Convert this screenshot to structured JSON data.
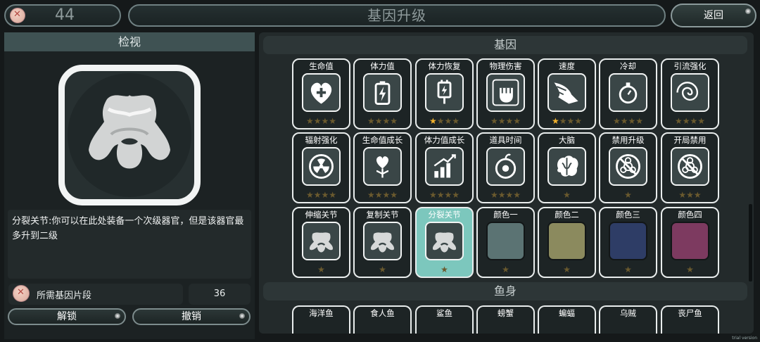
{
  "header": {
    "currency_value": "44",
    "title": "基因升级",
    "back_label": "返回"
  },
  "inspect": {
    "title": "检视",
    "description": "分裂关节:你可以在此处装备一个次级器官，但是该器官最多升到二级",
    "cost_label": "所需基因片段",
    "cost_value": "36",
    "unlock_label": "解锁",
    "cancel_label": "撤销"
  },
  "genes": {
    "title": "基因",
    "items": [
      {
        "name": "生命值",
        "icon": "heart-plus-icon",
        "stars": [
          0,
          0,
          0,
          0
        ]
      },
      {
        "name": "体力值",
        "icon": "battery-icon",
        "stars": [
          0,
          0,
          0,
          0
        ]
      },
      {
        "name": "体力恢复",
        "icon": "charger-icon",
        "stars": [
          1,
          0,
          0,
          0
        ]
      },
      {
        "name": "物理伤害",
        "icon": "fist-icon",
        "stars": [
          0,
          0,
          0,
          0
        ]
      },
      {
        "name": "速度",
        "icon": "winged-shoe-icon",
        "stars": [
          1,
          0,
          0,
          0
        ]
      },
      {
        "name": "冷却",
        "icon": "stopwatch-icon",
        "stars": [
          0,
          0,
          0,
          0
        ]
      },
      {
        "name": "引流强化",
        "icon": "vortex-icon",
        "stars": [
          0,
          0,
          0,
          0
        ]
      },
      {
        "name": "辐射强化",
        "icon": "radiation-icon",
        "stars": [
          0,
          0,
          0,
          0
        ]
      },
      {
        "name": "生命值成长",
        "icon": "heart-plant-icon",
        "stars": [
          0,
          0,
          0,
          0
        ]
      },
      {
        "name": "体力值成长",
        "icon": "growth-chart-icon",
        "stars": [
          0,
          0,
          0,
          0
        ]
      },
      {
        "name": "道具时间",
        "icon": "timer-apple-icon",
        "stars": [
          0,
          0,
          0,
          0
        ]
      },
      {
        "name": "大脑",
        "icon": "brain-icon",
        "stars": [
          0
        ]
      },
      {
        "name": "禁用升级",
        "icon": "biohazard-ban-icon",
        "stars": [
          0
        ]
      },
      {
        "name": "开局禁用",
        "icon": "biohazard-ban-icon",
        "stars": [
          0,
          0,
          0
        ]
      },
      {
        "name": "伸缩关节",
        "icon": "vertebra-icon",
        "stars": [
          0
        ]
      },
      {
        "name": "复制关节",
        "icon": "vertebra-icon",
        "stars": [
          0
        ]
      },
      {
        "name": "分裂关节",
        "icon": "vertebra-icon",
        "stars": [
          0
        ],
        "selected": true
      },
      {
        "name": "颜色一",
        "color": "#5b7373",
        "stars": [
          0
        ]
      },
      {
        "name": "颜色二",
        "color": "#8b8a5e",
        "stars": [
          0
        ]
      },
      {
        "name": "颜色三",
        "color": "#2e3d66",
        "stars": [
          0
        ]
      },
      {
        "name": "颜色四",
        "color": "#7d3a60",
        "stars": [
          0
        ]
      }
    ]
  },
  "fish": {
    "title": "鱼身",
    "items": [
      "海洋鱼",
      "食人鱼",
      "鲨鱼",
      "螃蟹",
      "蝙蝠",
      "乌贼",
      "丧尸鱼"
    ]
  },
  "watermark": "trial version",
  "colors": {
    "star_on": "#f3b22d",
    "star_off": "#6b5a2e",
    "selected_card": "#7cc7bd",
    "header_bar": "#3f5253"
  }
}
